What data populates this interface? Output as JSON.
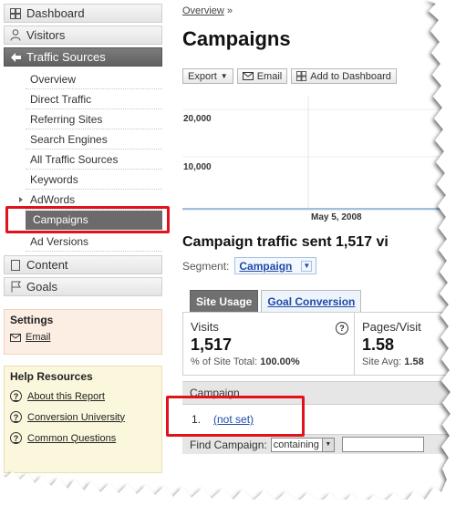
{
  "sidebar": {
    "nav": [
      {
        "label": "Dashboard",
        "icon": "grid-icon"
      },
      {
        "label": "Visitors",
        "icon": "person-icon"
      },
      {
        "label": "Traffic Sources",
        "icon": "traffic-icon"
      }
    ],
    "sub_items": [
      {
        "label": "Overview"
      },
      {
        "label": "Direct Traffic"
      },
      {
        "label": "Referring Sites"
      },
      {
        "label": "Search Engines"
      },
      {
        "label": "All Traffic Sources"
      },
      {
        "label": "Keywords"
      },
      {
        "label": "AdWords"
      },
      {
        "label": "Campaigns"
      },
      {
        "label": "Ad Versions"
      }
    ],
    "nav_bottom": [
      {
        "label": "Content",
        "icon": "page-icon"
      },
      {
        "label": "Goals",
        "icon": "flag-icon"
      }
    ],
    "settings": {
      "title": "Settings",
      "email_label": "Email"
    },
    "help": {
      "title": "Help Resources",
      "links": [
        "About this Report",
        "Conversion University",
        "Common Questions"
      ]
    }
  },
  "main": {
    "breadcrumb": {
      "link": "Overview",
      "sep": "»"
    },
    "title": "Campaigns",
    "toolbar": {
      "export": "Export",
      "email": "Email",
      "add_dashboard": "Add to Dashboard"
    },
    "chart": {
      "y_tick_high": "20,000",
      "y_tick_mid": "10,000",
      "x_label": "May 5, 2008"
    },
    "subtitle": "Campaign traffic sent 1,517 vi",
    "segment": {
      "label": "Segment:",
      "value": "Campaign"
    },
    "tabs": {
      "active": "Site Usage",
      "inactive": "Goal Conversion"
    },
    "metrics": {
      "visits": {
        "label": "Visits",
        "value": "1,517",
        "sub_prefix": "% of Site Total:",
        "sub_value": "100.00%"
      },
      "pages": {
        "label": "Pages/Visit",
        "value": "1.58",
        "sub_prefix": "Site Avg:",
        "sub_value": "1.58"
      }
    },
    "table": {
      "header": "Campaign",
      "rows": [
        {
          "index": "1.",
          "value": "(not set)"
        }
      ]
    },
    "find": {
      "label": "Find Campaign:",
      "mode": "containing"
    }
  },
  "colors": {
    "highlight": "#e1121b",
    "link": "#1f4aa8",
    "active_nav": "#6b6b6b"
  }
}
